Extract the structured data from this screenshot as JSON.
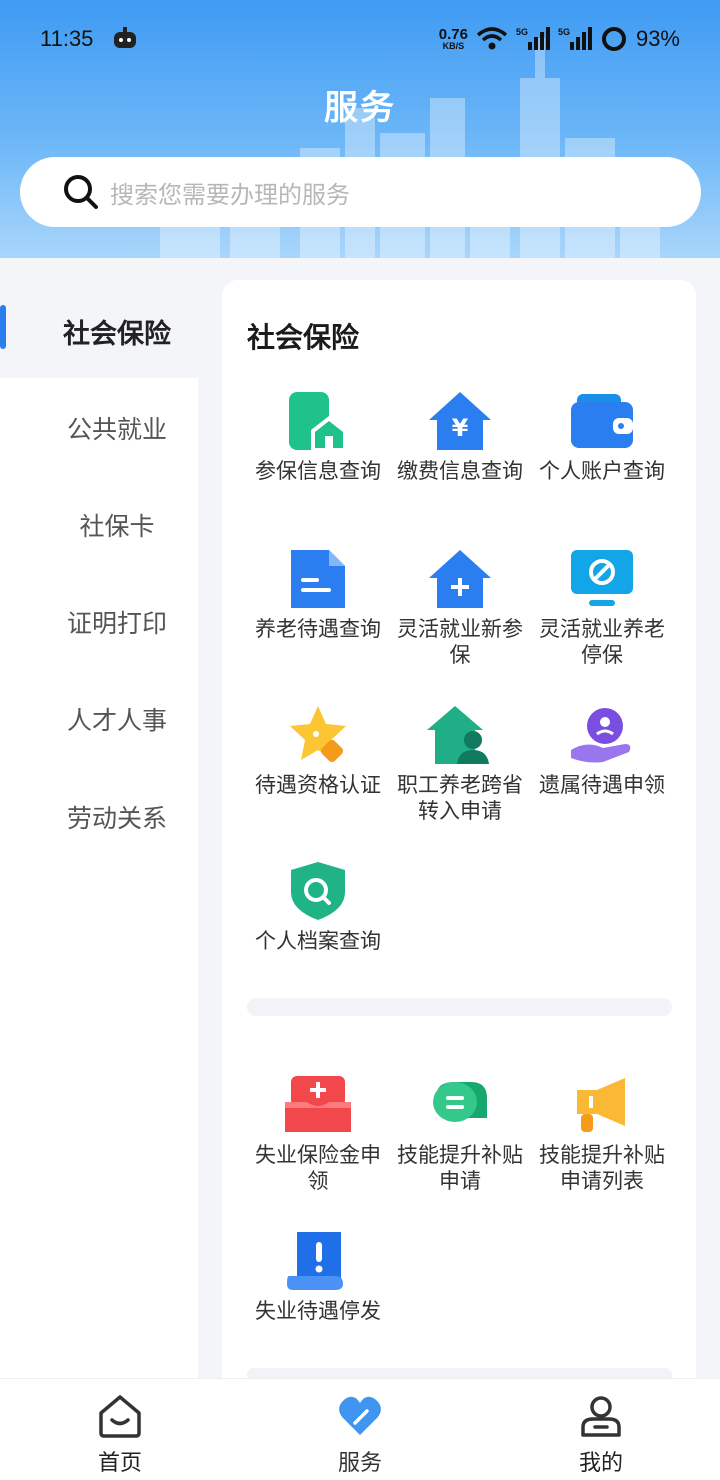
{
  "status_bar": {
    "time": "11:35",
    "net_speed_value": "0.76",
    "net_speed_unit": "KB/S",
    "battery_percent": "93%",
    "icons": [
      "robot-icon",
      "wifi-icon",
      "signal-5g-icon",
      "signal-5g-icon",
      "battery-ring-icon"
    ]
  },
  "header": {
    "title": "服务"
  },
  "search": {
    "placeholder": "搜索您需要办理的服务"
  },
  "sidebar": {
    "items": [
      {
        "label": "社会保险",
        "active": true
      },
      {
        "label": "公共就业"
      },
      {
        "label": "社保卡"
      },
      {
        "label": "证明打印"
      },
      {
        "label": "人才人事"
      },
      {
        "label": "劳动关系"
      }
    ]
  },
  "section": {
    "title": "社会保险",
    "services": [
      {
        "label": "参保信息查询",
        "icon": "phone-home-icon"
      },
      {
        "label": "缴费信息查询",
        "icon": "yuan-house-icon"
      },
      {
        "label": "个人账户查询",
        "icon": "wallet-icon"
      },
      {
        "label": "养老待遇查询",
        "icon": "document-icon"
      },
      {
        "label": "灵活就业新参保",
        "icon": "plus-house-icon"
      },
      {
        "label": "灵活就业养老停保",
        "icon": "monitor-stop-icon"
      },
      {
        "label": "待遇资格认证",
        "icon": "star-badge-icon"
      },
      {
        "label": "职工养老跨省转入申请",
        "icon": "house-person-icon"
      },
      {
        "label": "遗属待遇申领",
        "icon": "hand-coin-icon"
      },
      {
        "label": "个人档案查询",
        "icon": "shield-search-icon"
      }
    ],
    "services2": [
      {
        "label": "失业保险金申领",
        "icon": "red-box-plus-icon"
      },
      {
        "label": "技能提升补贴申请",
        "icon": "chat-bubble-icon"
      },
      {
        "label": "技能提升补贴申请列表",
        "icon": "megaphone-icon"
      },
      {
        "label": "失业待遇停发",
        "icon": "scroll-alert-icon"
      }
    ]
  },
  "tabbar": {
    "items": [
      {
        "label": "首页",
        "icon": "home-icon"
      },
      {
        "label": "服务",
        "icon": "heart-icon",
        "active": true
      },
      {
        "label": "我的",
        "icon": "person-icon"
      }
    ]
  },
  "colors": {
    "accent": "#2a7ef0",
    "header_top": "#3f9bf3",
    "header_bottom": "#a9d6fb"
  }
}
